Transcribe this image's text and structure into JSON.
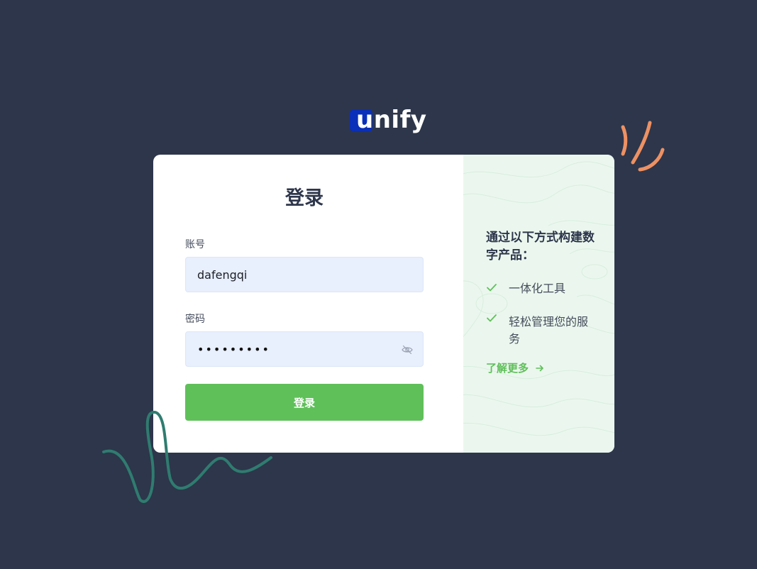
{
  "brand": {
    "name": "nify",
    "mark": "u",
    "mark_color": "#0a2fb8"
  },
  "login": {
    "title": "登录",
    "account_label": "账号",
    "account_value": "dafengqi",
    "password_label": "密码",
    "password_mask": "•••••••••",
    "submit_label": "登录"
  },
  "promo": {
    "title": "通过以下方式构建数字产品：",
    "features": [
      "一体化工具",
      "轻松管理您的服务"
    ],
    "learn_more": "了解更多"
  },
  "icons": {
    "password_toggle": "eye-off-icon",
    "check": "check-icon",
    "arrow": "arrow-right-icon"
  },
  "colors": {
    "background": "#2d364b",
    "accent": "#5fc05a",
    "input_bg": "#e8effd",
    "promo_bg": "#ebf7ee",
    "squiggle": "#2f7c70",
    "spark": "#ee9163"
  }
}
